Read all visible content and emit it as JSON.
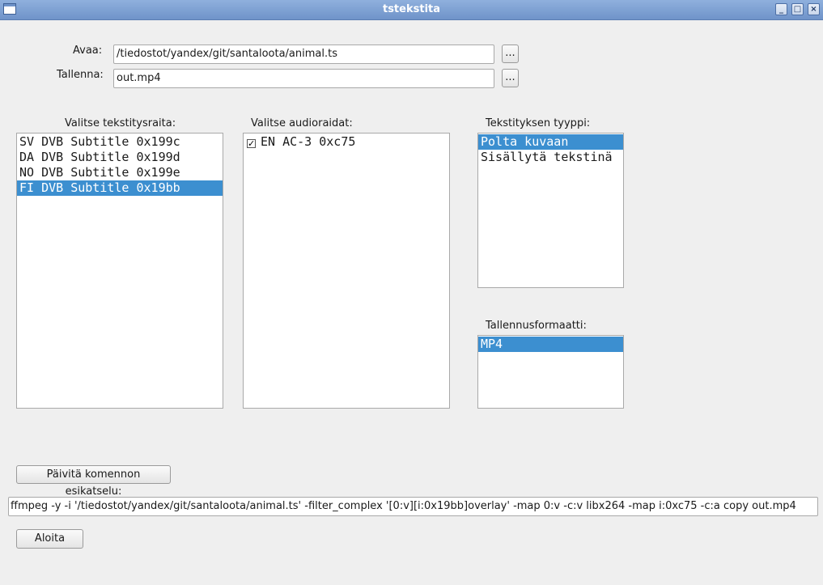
{
  "window": {
    "title": "tstekstita"
  },
  "open": {
    "label": "Avaa:",
    "value": "/tiedostot/yandex/git/santaloota/animal.ts",
    "browse_label": "..."
  },
  "save": {
    "label": "Tallenna:",
    "value": "out.mp4",
    "browse_label": "..."
  },
  "subtitles": {
    "label": "Valitse tekstitysraita:",
    "items": [
      {
        "text": "SV DVB Subtitle 0x199c",
        "selected": false
      },
      {
        "text": "DA DVB Subtitle 0x199d",
        "selected": false
      },
      {
        "text": "NO DVB Subtitle 0x199e",
        "selected": false
      },
      {
        "text": "FI DVB Subtitle 0x19bb",
        "selected": true
      }
    ]
  },
  "audio": {
    "label": "Valitse audioraidat:",
    "items": [
      {
        "text": "EN AC-3 0xc75",
        "checked": true,
        "check_glyph": "✓"
      }
    ]
  },
  "subtitle_type": {
    "label": "Tekstityksen tyyppi:",
    "items": [
      {
        "text": "Polta kuvaan",
        "selected": true
      },
      {
        "text": "Sisällytä tekstinä",
        "selected": false
      }
    ]
  },
  "format": {
    "label": "Tallennusformaatti:",
    "items": [
      {
        "text": "MP4",
        "selected": true
      }
    ]
  },
  "preview_button": {
    "label": "Päivitä komennon esikatselu:"
  },
  "command": {
    "value": "ffmpeg -y -i '/tiedostot/yandex/git/santaloota/animal.ts' -filter_complex '[0:v][i:0x19bb]overlay' -map 0:v -c:v libx264 -map i:0xc75 -c:a copy   out.mp4"
  },
  "start_button": {
    "label": "Aloita"
  },
  "titlebar_buttons": {
    "minimize": "_",
    "maximize": "□",
    "close": "×"
  },
  "colors": {
    "selection": "#3c8fd0",
    "titlebar": "#7a9dd2",
    "background": "#efefef"
  }
}
